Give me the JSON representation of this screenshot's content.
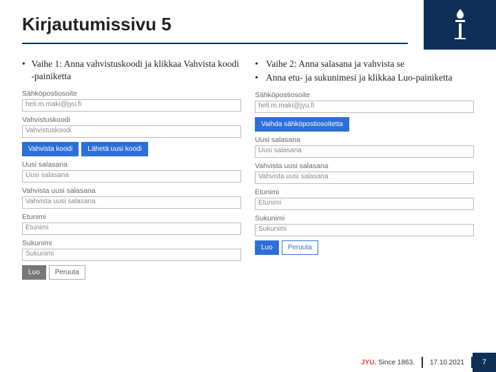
{
  "title": "Kirjautumissivu 5",
  "left": {
    "bullets": [
      "Vaihe 1: Anna vahvistuskoodi ja klikkaa Vahvista koodi -painiketta"
    ],
    "form": {
      "email_label": "Sähköpostiosoite",
      "email_value": "heli.m.maki@jyu.fi",
      "code_label": "Vahvistuskoodi",
      "code_placeholder": "Vahvistuskoodi",
      "btn_confirm": "Vahvista koodi",
      "btn_resend": "Lähetä uusi koodi",
      "newpw_label": "Uusi salasana",
      "newpw_placeholder": "Uusi salasana",
      "confpw_label": "Vahvista uusi salasana",
      "confpw_placeholder": "Vahvista uusi salasana",
      "first_label": "Etunimi",
      "first_placeholder": "Etunimi",
      "last_label": "Sukunimi",
      "last_placeholder": "Sukunimi",
      "btn_create": "Luo",
      "btn_cancel": "Peruuta"
    }
  },
  "right": {
    "bullets": [
      "Vaihe 2: Anna salasana ja vahvista se",
      "Anna etu- ja sukunimesi ja klikkaa Luo-painiketta"
    ],
    "form": {
      "email_label": "Sähköpostiosoite",
      "email_value": "heli.m.maki@jyu.fi",
      "btn_change": "Vaihda sähköpostiosoitetta",
      "newpw_label": "Uusi salasana",
      "newpw_placeholder": "Uusi salasana",
      "confpw_label": "Vahvista uusi salasana",
      "confpw_placeholder": "Vahvista uusi salasana",
      "first_label": "Etunimi",
      "first_placeholder": "Etunimi",
      "last_label": "Sukunimi",
      "last_placeholder": "Sukunimi",
      "btn_create": "Luo",
      "btn_cancel": "Peruuta"
    }
  },
  "footer": {
    "jyu": "JYU.",
    "since": "Since 1863.",
    "date": "17.10.2021",
    "page": "7"
  }
}
